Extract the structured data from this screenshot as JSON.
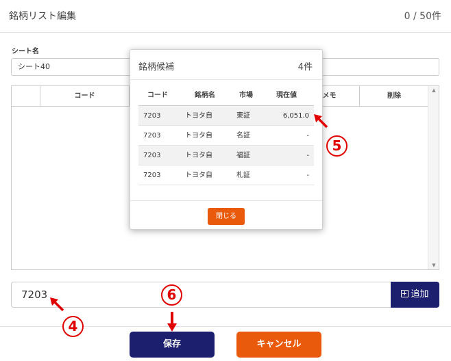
{
  "header": {
    "title": "銘柄リスト編集",
    "count": "0 / 50件"
  },
  "sheet": {
    "label": "シート名",
    "value": "シート40"
  },
  "grid": {
    "columns": [
      "コード",
      "メモ",
      "削除"
    ],
    "scroll_up": "▲",
    "scroll_down": "▼"
  },
  "entry": {
    "code_value": "7203",
    "add_label": "追加"
  },
  "footer": {
    "save_label": "保存",
    "cancel_label": "キャンセル"
  },
  "modal": {
    "title": "銘柄候補",
    "count": "4件",
    "columns": {
      "code": "コード",
      "name": "銘柄名",
      "market": "市場",
      "price": "現在値"
    },
    "rows": [
      {
        "code": "7203",
        "name": "トヨタ自",
        "market": "東証",
        "price": "6,051.0"
      },
      {
        "code": "7203",
        "name": "トヨタ自",
        "market": "名証",
        "price": "-"
      },
      {
        "code": "7203",
        "name": "トヨタ自",
        "market": "福証",
        "price": "-"
      },
      {
        "code": "7203",
        "name": "トヨタ自",
        "market": "札証",
        "price": "-"
      }
    ],
    "close_label": "閉じる"
  },
  "annotations": {
    "m4": "4",
    "m5": "5",
    "m6": "6",
    "color": "#e00000"
  },
  "colors": {
    "navy": "#1b1f6e",
    "orange": "#ea5a0c"
  }
}
